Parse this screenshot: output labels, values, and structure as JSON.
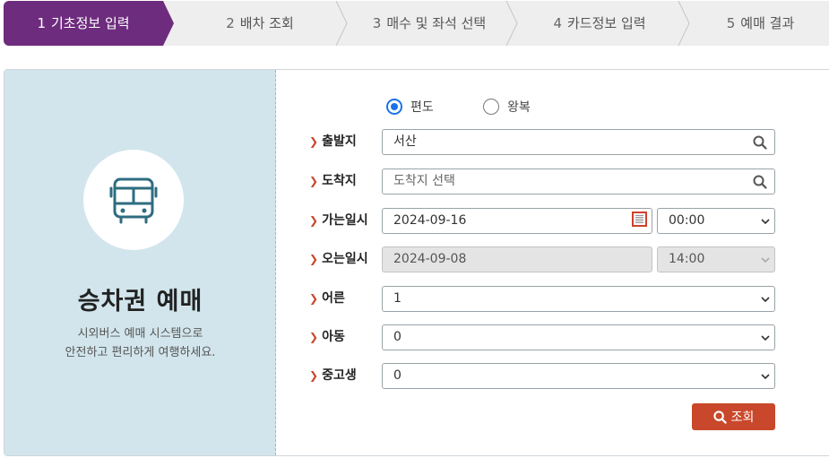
{
  "steps": [
    {
      "num": "1",
      "label": "기초정보 입력",
      "active": true
    },
    {
      "num": "2",
      "label": "배차 조회",
      "active": false
    },
    {
      "num": "3",
      "label": "매수 및 좌석 선택",
      "active": false
    },
    {
      "num": "4",
      "label": "카드정보 입력",
      "active": false
    },
    {
      "num": "5",
      "label": "예매 결과",
      "active": false
    }
  ],
  "panel": {
    "icon": "bus-icon",
    "title": "승차권 예매",
    "desc_line1": "시외버스 예매 시스템으로",
    "desc_line2": "안전하고 편리하게 여행하세요."
  },
  "trip_type": {
    "selected": "편도",
    "one_way": "편도",
    "round_trip": "왕복"
  },
  "form": {
    "departure": {
      "label": "출발지",
      "value": "서산"
    },
    "arrival": {
      "label": "도착지",
      "placeholder": "도착지 선택"
    },
    "go_date": {
      "label": "가는일시",
      "date": "2024-09-16",
      "time": "00:00"
    },
    "return_date": {
      "label": "오는일시",
      "date": "2024-09-08",
      "time": "14:00"
    },
    "adult": {
      "label": "어른",
      "value": "1"
    },
    "child": {
      "label": "아동",
      "value": "0"
    },
    "teen": {
      "label": "중고생",
      "value": "0"
    }
  },
  "search_button": "조회",
  "colors": {
    "active_step": "#6e2c7e",
    "panel_bg": "#d2e5ec",
    "accent": "#c9482b",
    "radio": "#1a73e8"
  }
}
